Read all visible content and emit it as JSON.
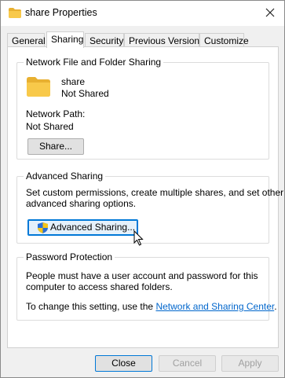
{
  "window": {
    "title": "share Properties"
  },
  "tabs": [
    {
      "label": "General"
    },
    {
      "label": "Sharing"
    },
    {
      "label": "Security"
    },
    {
      "label": "Previous Versions"
    },
    {
      "label": "Customize"
    }
  ],
  "network_sharing": {
    "legend": "Network File and Folder Sharing",
    "folder_name": "share",
    "folder_status": "Not Shared",
    "path_label": "Network Path:",
    "path_value": "Not Shared",
    "share_button": "Share..."
  },
  "advanced_sharing": {
    "legend": "Advanced Sharing",
    "description_line1": "Set custom permissions, create multiple shares, and set other",
    "description_line2": "advanced sharing options.",
    "button": "Advanced Sharing..."
  },
  "password_protection": {
    "legend": "Password Protection",
    "line1": "People must have a user account and password for this",
    "line2": "computer to access shared folders.",
    "change_prefix": "To change this setting, use the ",
    "link_text": "Network and Sharing Center",
    "change_suffix": "."
  },
  "footer": {
    "close": "Close",
    "cancel": "Cancel",
    "apply": "Apply"
  },
  "colors": {
    "accent": "#0078d7",
    "folder": "#f8c94a",
    "link": "#0066cc"
  }
}
